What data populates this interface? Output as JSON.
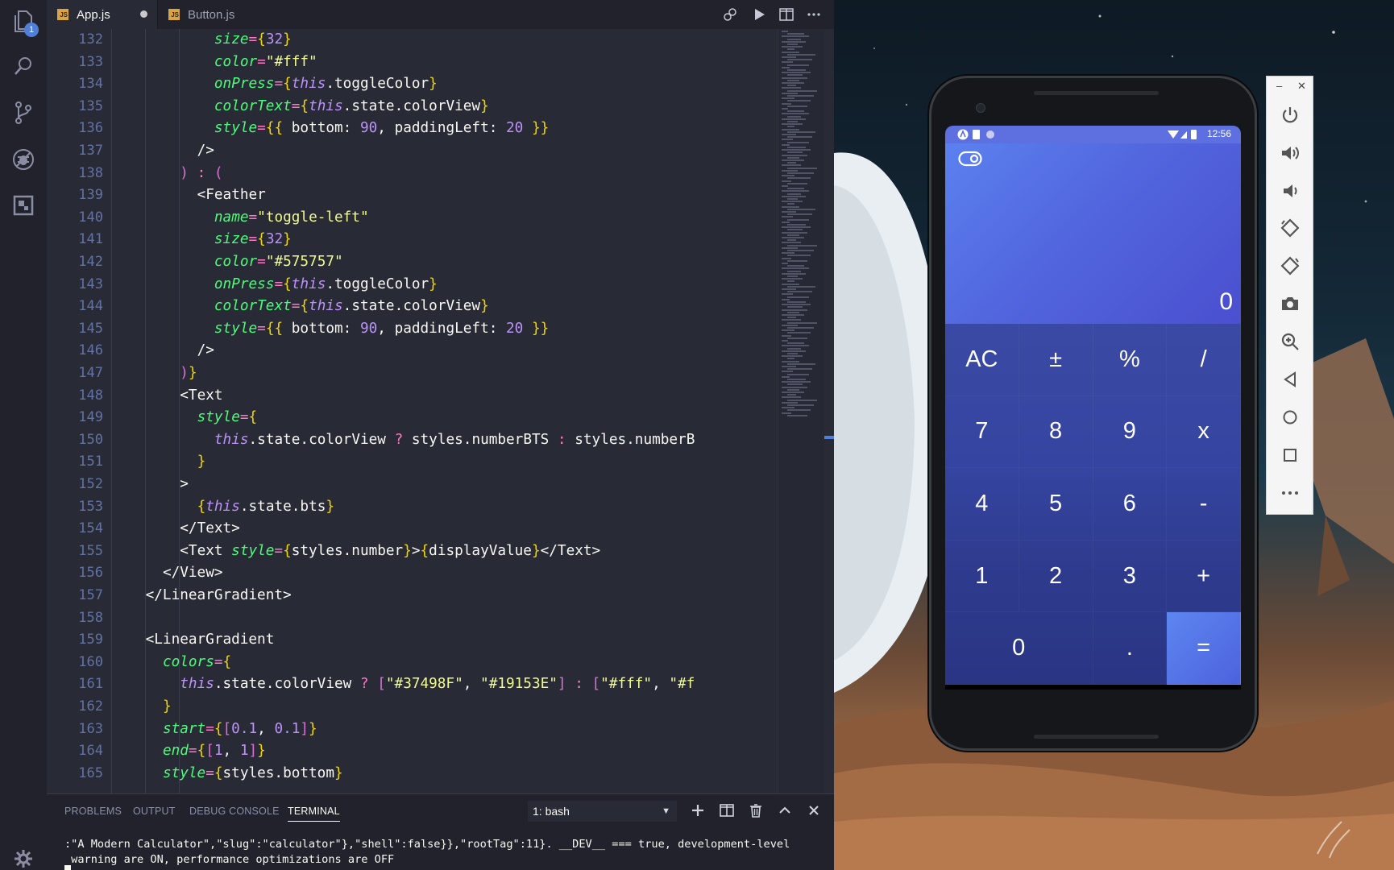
{
  "editor": {
    "tabs": [
      {
        "label": "App.js",
        "active": true,
        "modified": true
      },
      {
        "label": "Button.js",
        "active": false,
        "modified": false
      }
    ],
    "activity_badge": "1",
    "lines": [
      {
        "n": "132",
        "indent": 12,
        "tokens": [
          [
            "size",
            "t-attr"
          ],
          [
            "=",
            "t-pink"
          ],
          [
            "{",
            "t-br"
          ],
          [
            "32",
            "t-num"
          ],
          [
            "}",
            "t-br"
          ]
        ]
      },
      {
        "n": "133",
        "indent": 12,
        "tokens": [
          [
            "color",
            "t-attr"
          ],
          [
            "=",
            "t-pink"
          ],
          [
            "\"#fff\"",
            "t-str"
          ]
        ]
      },
      {
        "n": "134",
        "indent": 12,
        "tokens": [
          [
            "onPress",
            "t-attr"
          ],
          [
            "=",
            "t-pink"
          ],
          [
            "{",
            "t-br"
          ],
          [
            "this",
            "t-this"
          ],
          [
            ".",
            "t-prop"
          ],
          [
            "toggleColor",
            "t-prop"
          ],
          [
            "}",
            "t-br"
          ]
        ]
      },
      {
        "n": "135",
        "indent": 12,
        "tokens": [
          [
            "colorText",
            "t-attr"
          ],
          [
            "=",
            "t-pink"
          ],
          [
            "{",
            "t-br"
          ],
          [
            "this",
            "t-this"
          ],
          [
            ".",
            "t-prop"
          ],
          [
            "state",
            "t-prop"
          ],
          [
            ".",
            "t-prop"
          ],
          [
            "colorView",
            "t-prop"
          ],
          [
            "}",
            "t-br"
          ]
        ]
      },
      {
        "n": "136",
        "indent": 12,
        "tokens": [
          [
            "style",
            "t-attr"
          ],
          [
            "=",
            "t-pink"
          ],
          [
            "{{",
            "t-br"
          ],
          [
            " bottom: ",
            "t-prop"
          ],
          [
            "90",
            "t-num"
          ],
          [
            ", paddingLeft: ",
            "t-prop"
          ],
          [
            "20",
            "t-num"
          ],
          [
            " ",
            "t-prop"
          ],
          [
            "}}",
            "t-br"
          ]
        ]
      },
      {
        "n": "137",
        "indent": 10,
        "tokens": [
          [
            "/>",
            "t-tag"
          ]
        ]
      },
      {
        "n": "138",
        "indent": 8,
        "tokens": [
          [
            ")",
            "t-br2"
          ],
          [
            " : ",
            "t-pink"
          ],
          [
            "(",
            "t-br2"
          ]
        ]
      },
      {
        "n": "139",
        "indent": 10,
        "tokens": [
          [
            "<Feather",
            "t-tag"
          ]
        ]
      },
      {
        "n": "140",
        "indent": 12,
        "tokens": [
          [
            "name",
            "t-attr"
          ],
          [
            "=",
            "t-pink"
          ],
          [
            "\"toggle-left\"",
            "t-str"
          ]
        ]
      },
      {
        "n": "141",
        "indent": 12,
        "tokens": [
          [
            "size",
            "t-attr"
          ],
          [
            "=",
            "t-pink"
          ],
          [
            "{",
            "t-br"
          ],
          [
            "32",
            "t-num"
          ],
          [
            "}",
            "t-br"
          ]
        ]
      },
      {
        "n": "142",
        "indent": 12,
        "tokens": [
          [
            "color",
            "t-attr"
          ],
          [
            "=",
            "t-pink"
          ],
          [
            "\"#575757\"",
            "t-str"
          ]
        ]
      },
      {
        "n": "143",
        "indent": 12,
        "tokens": [
          [
            "onPress",
            "t-attr"
          ],
          [
            "=",
            "t-pink"
          ],
          [
            "{",
            "t-br"
          ],
          [
            "this",
            "t-this"
          ],
          [
            ".",
            "t-prop"
          ],
          [
            "toggleColor",
            "t-prop"
          ],
          [
            "}",
            "t-br"
          ]
        ]
      },
      {
        "n": "144",
        "indent": 12,
        "tokens": [
          [
            "colorText",
            "t-attr"
          ],
          [
            "=",
            "t-pink"
          ],
          [
            "{",
            "t-br"
          ],
          [
            "this",
            "t-this"
          ],
          [
            ".",
            "t-prop"
          ],
          [
            "state",
            "t-prop"
          ],
          [
            ".",
            "t-prop"
          ],
          [
            "colorView",
            "t-prop"
          ],
          [
            "}",
            "t-br"
          ]
        ]
      },
      {
        "n": "145",
        "indent": 12,
        "tokens": [
          [
            "style",
            "t-attr"
          ],
          [
            "=",
            "t-pink"
          ],
          [
            "{{",
            "t-br"
          ],
          [
            " bottom: ",
            "t-prop"
          ],
          [
            "90",
            "t-num"
          ],
          [
            ", paddingLeft: ",
            "t-prop"
          ],
          [
            "20",
            "t-num"
          ],
          [
            " ",
            "t-prop"
          ],
          [
            "}}",
            "t-br"
          ]
        ]
      },
      {
        "n": "146",
        "indent": 10,
        "tokens": [
          [
            "/>",
            "t-tag"
          ]
        ]
      },
      {
        "n": "147",
        "indent": 8,
        "tokens": [
          [
            ")",
            "t-br2"
          ],
          [
            "}",
            "t-br"
          ]
        ]
      },
      {
        "n": "148",
        "indent": 8,
        "tokens": [
          [
            "<Text",
            "t-tag"
          ]
        ]
      },
      {
        "n": "149",
        "indent": 10,
        "tokens": [
          [
            "style",
            "t-attr"
          ],
          [
            "=",
            "t-pink"
          ],
          [
            "{",
            "t-br"
          ]
        ]
      },
      {
        "n": "150",
        "indent": 12,
        "tokens": [
          [
            "this",
            "t-this"
          ],
          [
            ".",
            "t-prop"
          ],
          [
            "state",
            "t-prop"
          ],
          [
            ".",
            "t-prop"
          ],
          [
            "colorView",
            "t-prop"
          ],
          [
            " ? ",
            "t-pink"
          ],
          [
            "styles",
            "t-prop"
          ],
          [
            ".",
            "t-prop"
          ],
          [
            "numberBTS",
            "t-prop"
          ],
          [
            " : ",
            "t-pink"
          ],
          [
            "styles",
            "t-prop"
          ],
          [
            ".",
            "t-prop"
          ],
          [
            "numberB",
            "t-prop"
          ]
        ]
      },
      {
        "n": "151",
        "indent": 10,
        "tokens": [
          [
            "}",
            "t-br"
          ]
        ]
      },
      {
        "n": "152",
        "indent": 8,
        "tokens": [
          [
            ">",
            "t-tag"
          ]
        ]
      },
      {
        "n": "153",
        "indent": 10,
        "tokens": [
          [
            "{",
            "t-br"
          ],
          [
            "this",
            "t-this"
          ],
          [
            ".",
            "t-prop"
          ],
          [
            "state",
            "t-prop"
          ],
          [
            ".",
            "t-prop"
          ],
          [
            "bts",
            "t-prop"
          ],
          [
            "}",
            "t-br"
          ]
        ]
      },
      {
        "n": "154",
        "indent": 8,
        "tokens": [
          [
            "</Text>",
            "t-tag"
          ]
        ]
      },
      {
        "n": "155",
        "indent": 8,
        "tokens": [
          [
            "<Text ",
            "t-tag"
          ],
          [
            "style",
            "t-attr"
          ],
          [
            "=",
            "t-pink"
          ],
          [
            "{",
            "t-br"
          ],
          [
            "styles",
            "t-prop"
          ],
          [
            ".",
            "t-prop"
          ],
          [
            "number",
            "t-prop"
          ],
          [
            "}",
            "t-br"
          ],
          [
            ">",
            "t-tag"
          ],
          [
            "{",
            "t-br"
          ],
          [
            "displayValue",
            "t-prop"
          ],
          [
            "}",
            "t-br"
          ],
          [
            "</Text>",
            "t-tag"
          ]
        ]
      },
      {
        "n": "156",
        "indent": 6,
        "tokens": [
          [
            "</View>",
            "t-tag"
          ]
        ]
      },
      {
        "n": "157",
        "indent": 4,
        "tokens": [
          [
            "</LinearGradient>",
            "t-tag"
          ]
        ]
      },
      {
        "n": "158",
        "indent": 0,
        "tokens": []
      },
      {
        "n": "159",
        "indent": 4,
        "tokens": [
          [
            "<LinearGradient",
            "t-tag"
          ]
        ]
      },
      {
        "n": "160",
        "indent": 6,
        "tokens": [
          [
            "colors",
            "t-attr"
          ],
          [
            "=",
            "t-pink"
          ],
          [
            "{",
            "t-br"
          ]
        ]
      },
      {
        "n": "161",
        "indent": 8,
        "tokens": [
          [
            "this",
            "t-this"
          ],
          [
            ".",
            "t-prop"
          ],
          [
            "state",
            "t-prop"
          ],
          [
            ".",
            "t-prop"
          ],
          [
            "colorView",
            "t-prop"
          ],
          [
            " ? ",
            "t-pink"
          ],
          [
            "[",
            "t-br2"
          ],
          [
            "\"#37498F\"",
            "t-str"
          ],
          [
            ", ",
            "t-prop"
          ],
          [
            "\"#19153E\"",
            "t-str"
          ],
          [
            "]",
            "t-br2"
          ],
          [
            " : ",
            "t-pink"
          ],
          [
            "[",
            "t-br2"
          ],
          [
            "\"#fff\"",
            "t-str"
          ],
          [
            ", ",
            "t-prop"
          ],
          [
            "\"#f",
            "t-str"
          ]
        ]
      },
      {
        "n": "162",
        "indent": 6,
        "tokens": [
          [
            "}",
            "t-br"
          ]
        ]
      },
      {
        "n": "163",
        "indent": 6,
        "tokens": [
          [
            "start",
            "t-attr"
          ],
          [
            "=",
            "t-pink"
          ],
          [
            "{",
            "t-br"
          ],
          [
            "[",
            "t-br2"
          ],
          [
            "0.1",
            "t-num"
          ],
          [
            ", ",
            "t-prop"
          ],
          [
            "0.1",
            "t-num"
          ],
          [
            "]",
            "t-br2"
          ],
          [
            "}",
            "t-br"
          ]
        ]
      },
      {
        "n": "164",
        "indent": 6,
        "tokens": [
          [
            "end",
            "t-attr"
          ],
          [
            "=",
            "t-pink"
          ],
          [
            "{",
            "t-br"
          ],
          [
            "[",
            "t-br2"
          ],
          [
            "1",
            "t-num"
          ],
          [
            ", ",
            "t-prop"
          ],
          [
            "1",
            "t-num"
          ],
          [
            "]",
            "t-br2"
          ],
          [
            "}",
            "t-br"
          ]
        ]
      },
      {
        "n": "165",
        "indent": 6,
        "tokens": [
          [
            "style",
            "t-attr"
          ],
          [
            "=",
            "t-pink"
          ],
          [
            "{",
            "t-br"
          ],
          [
            "styles",
            "t-prop"
          ],
          [
            ".",
            "t-prop"
          ],
          [
            "bottom",
            "t-prop"
          ],
          [
            "}",
            "t-br"
          ]
        ]
      }
    ]
  },
  "panel": {
    "tabs": [
      "PROBLEMS",
      "OUTPUT",
      "DEBUG CONSOLE",
      "TERMINAL"
    ],
    "active_tab": "TERMINAL",
    "terminal_select": "1: bash",
    "terminal_lines": [
      ":\"A Modern Calculator\",\"slug\":\"calculator\"},\"shell\":false}},\"rootTag\":11}. __DEV__ === true, development-level",
      " warning are ON, performance optimizations are OFF"
    ]
  },
  "phone": {
    "clock": "12:56",
    "display_value": "0",
    "keys": [
      [
        "AC",
        "±",
        "%",
        "/"
      ],
      [
        "7",
        "8",
        "9",
        "x"
      ],
      [
        "4",
        "5",
        "6",
        "-"
      ],
      [
        "1",
        "2",
        "3",
        "+"
      ],
      [
        "0",
        ".",
        "="
      ]
    ]
  },
  "emulator_toolbar": {
    "minimize": "–",
    "close": "✕",
    "icons": [
      "power-icon",
      "volume-up-icon",
      "volume-down-icon",
      "rotate-left-icon",
      "rotate-right-icon",
      "camera-icon",
      "zoom-icon",
      "back-icon",
      "home-icon",
      "overview-icon",
      "more-icon"
    ]
  },
  "colors": {
    "editor_bg": "#282a36",
    "calc_display_start": "#5b81ef",
    "calc_display_end": "#4a4fcf",
    "calc_keypad": "#3444a0",
    "calc_equals": "#5d86f0"
  }
}
